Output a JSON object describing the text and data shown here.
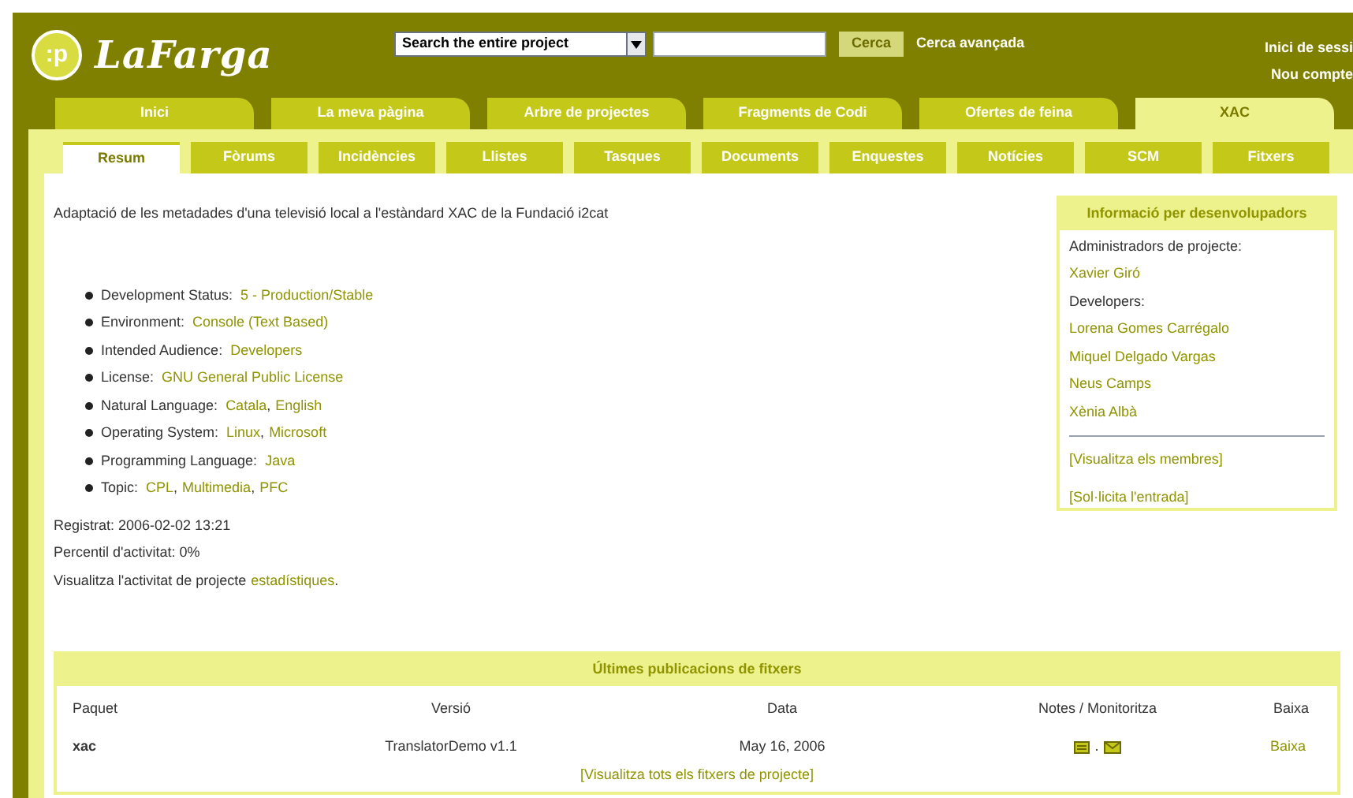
{
  "header": {
    "logo_mark": ":p",
    "logo_text": "LaFarga",
    "search_scope": "Search the entire project",
    "search_button": "Cerca",
    "advanced_search": "Cerca avançada",
    "account_links": [
      "Inici de sessi",
      "Nou compte"
    ]
  },
  "main_tabs": [
    {
      "label": "Inici",
      "selected": false
    },
    {
      "label": "La meva pàgina",
      "selected": false
    },
    {
      "label": "Arbre de projectes",
      "selected": false
    },
    {
      "label": "Fragments de Codi",
      "selected": false
    },
    {
      "label": "Ofertes de feina",
      "selected": false
    },
    {
      "label": "XAC",
      "selected": true
    }
  ],
  "sub_tabs": [
    {
      "label": "Resum",
      "selected": true
    },
    {
      "label": "Fòrums",
      "selected": false
    },
    {
      "label": "Incidències",
      "selected": false
    },
    {
      "label": "Llistes",
      "selected": false
    },
    {
      "label": "Tasques",
      "selected": false
    },
    {
      "label": "Documents",
      "selected": false
    },
    {
      "label": "Enquestes",
      "selected": false
    },
    {
      "label": "Notícies",
      "selected": false
    },
    {
      "label": "SCM",
      "selected": false
    },
    {
      "label": "Fitxers",
      "selected": false
    }
  ],
  "description": "Adaptació de les metadades d'una televisió local a l'estàndard XAC de la Fundació i2cat",
  "trove": [
    {
      "label": "Development Status:",
      "values": [
        "5 - Production/Stable"
      ]
    },
    {
      "label": "Environment:",
      "values": [
        "Console (Text Based)"
      ]
    },
    {
      "label": "Intended Audience:",
      "values": [
        "Developers"
      ]
    },
    {
      "label": "License:",
      "values": [
        "GNU General Public License"
      ]
    },
    {
      "label": "Natural Language:",
      "values": [
        "Catala",
        "English"
      ],
      "separator": ","
    },
    {
      "label": "Operating System:",
      "values": [
        "Linux",
        "Microsoft"
      ],
      "separator": ","
    },
    {
      "label": "Programming Language:",
      "values": [
        "Java"
      ]
    },
    {
      "label": "Topic:",
      "values": [
        "CPL",
        "Multimedia",
        "PFC"
      ],
      "separator": ","
    }
  ],
  "registered": "Registrat: 2006-02-02 13:21",
  "activity": "Percentil d'activitat: 0%",
  "stats": {
    "text": "Visualitza l'activitat de projecte",
    "link": "estadístiques",
    "after": "."
  },
  "developer_info": {
    "title": "Informació per desenvolupadors",
    "admins_label": "Administradors de projecte:",
    "admins": [
      "Xavier Giró"
    ],
    "developers_label": "Developers:",
    "developers": [
      "Lorena Gomes Carrégalo",
      "Miquel Delgado Vargas",
      "Neus Camps",
      "Xènia Albà"
    ],
    "links": [
      "[Visualitza els membres]",
      "[Sol·licita l'entrada]"
    ]
  },
  "releases": {
    "title": "Últimes publicacions de fitxers",
    "columns": [
      "Paquet",
      "Versió",
      "Data",
      "Notes / Monitoritza",
      "Baixa"
    ],
    "rows": [
      {
        "package": "xac",
        "version": "TranslatorDemo v1.1",
        "date": "May 16, 2006",
        "separator": ".",
        "download": "Baixa"
      }
    ],
    "footer_link": "[Visualitza tots els fitxers de projecte]"
  }
}
